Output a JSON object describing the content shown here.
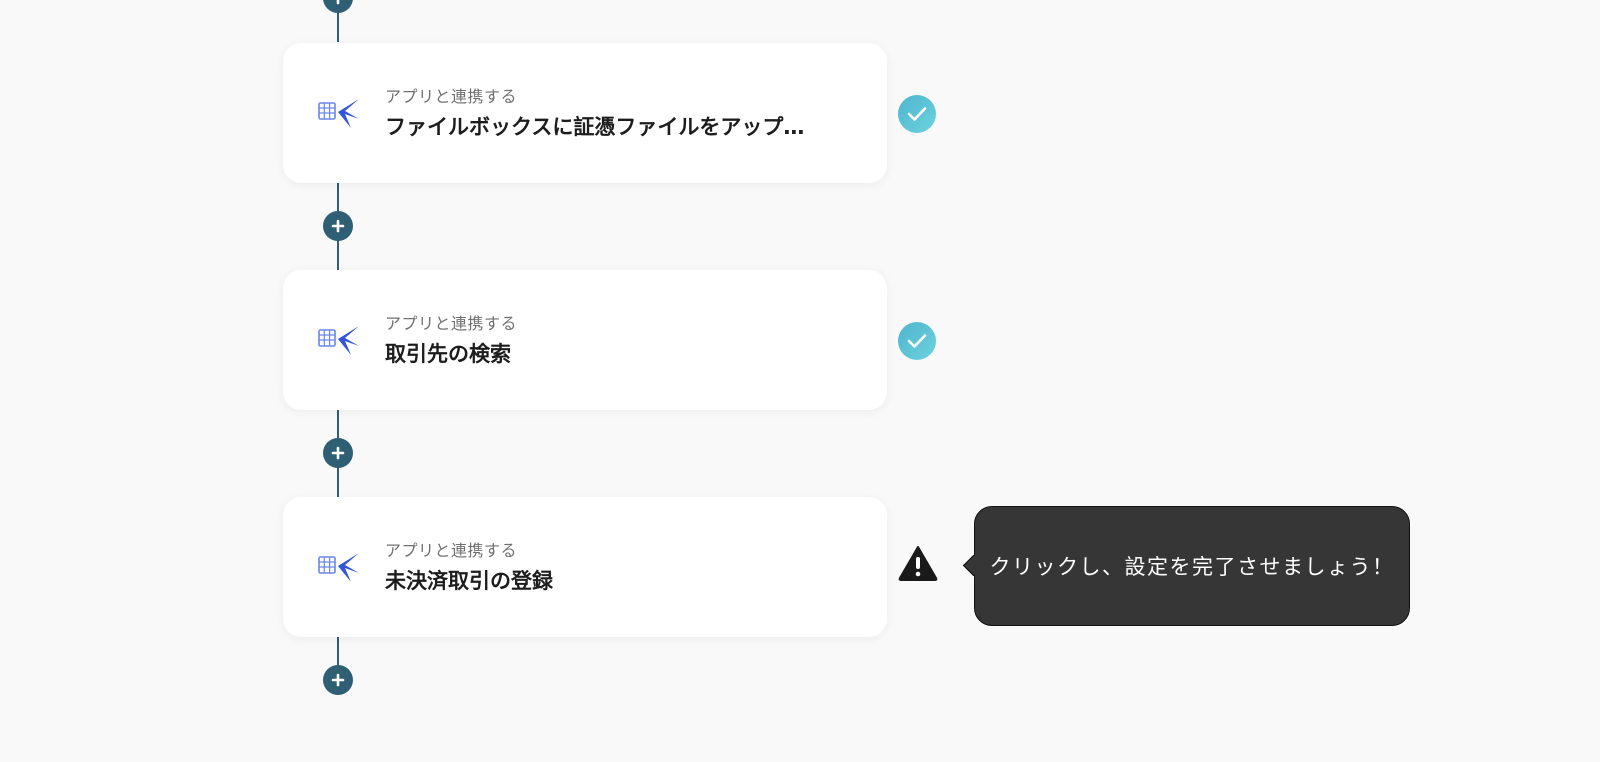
{
  "flow": {
    "steps": [
      {
        "caption": "アプリと連携する",
        "title": "ファイルボックスに証憑ファイルをアップ…",
        "icon": "freee-accounting-icon",
        "status": "complete"
      },
      {
        "caption": "アプリと連携する",
        "title": "取引先の検索",
        "icon": "freee-accounting-icon",
        "status": "complete"
      },
      {
        "caption": "アプリと連携する",
        "title": "未決済取引の登録",
        "icon": "freee-accounting-icon",
        "status": "incomplete"
      }
    ],
    "add_step_icon": "plus-icon"
  },
  "tooltip": {
    "text": "クリックし、設定を完了させましょう！"
  },
  "colors": {
    "background": "#f9f9f9",
    "connector": "#2e5f74",
    "check_gradient_start": "#4fb4cf",
    "check_gradient_end": "#6cd3dd",
    "warning": "#1a1a1a",
    "tooltip_bg": "#363636"
  }
}
